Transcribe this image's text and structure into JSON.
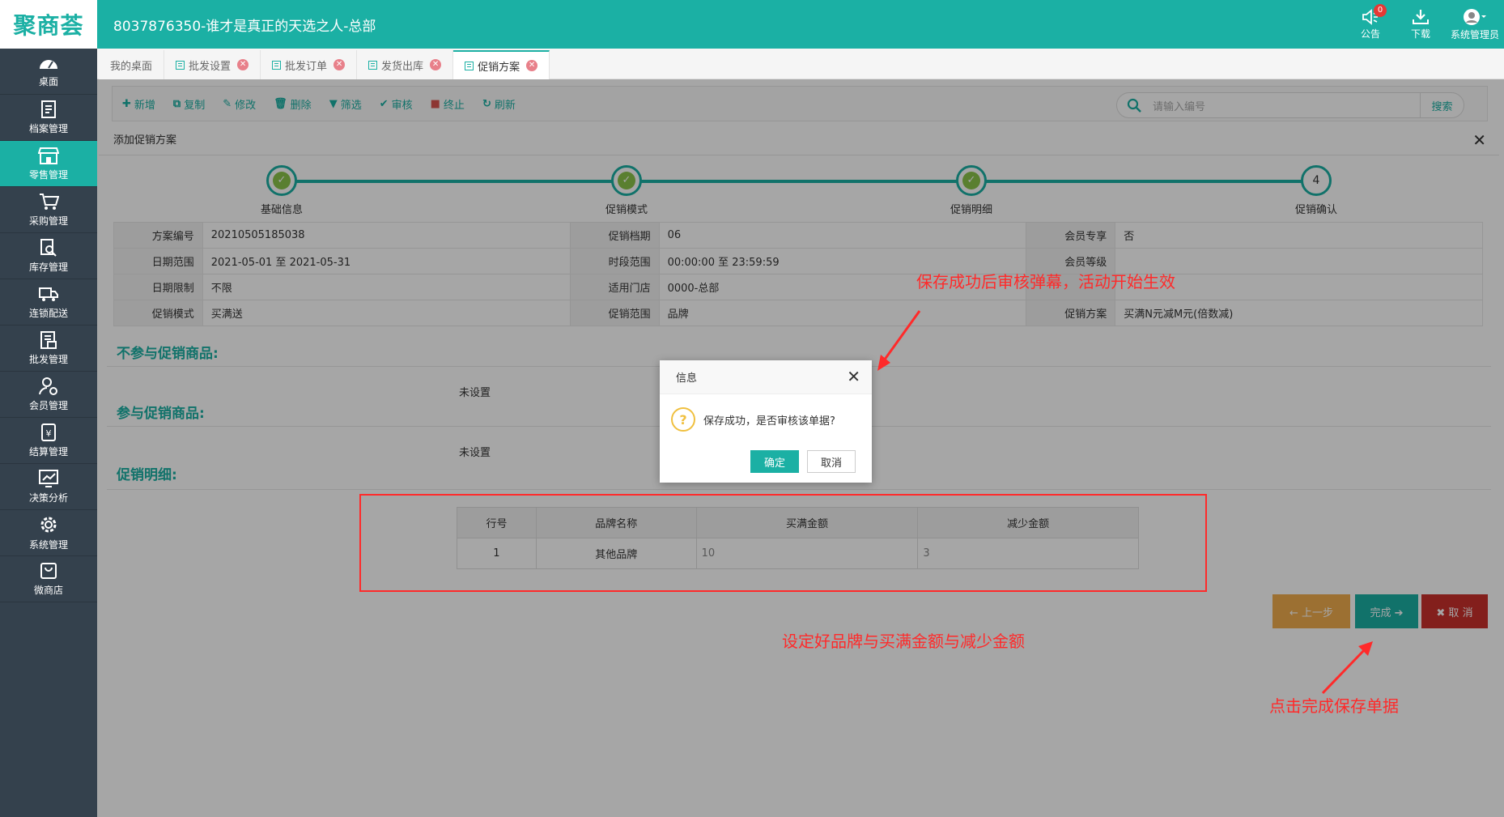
{
  "app": {
    "logo": "聚商荟",
    "title": "8037876350-谁才是真正的天选之人-总部"
  },
  "top_icons": [
    {
      "label": "公告",
      "icon": "speaker-icon",
      "badge": "0"
    },
    {
      "label": "下载",
      "icon": "download-icon"
    },
    {
      "label": "系统管理员",
      "icon": "avatar-icon"
    }
  ],
  "sidebar": [
    {
      "label": "桌面",
      "icon": "dashboard-icon"
    },
    {
      "label": "档案管理",
      "icon": "archive-icon"
    },
    {
      "label": "零售管理",
      "icon": "store-icon",
      "active": true
    },
    {
      "label": "采购管理",
      "icon": "cart-icon"
    },
    {
      "label": "库存管理",
      "icon": "inventory-icon"
    },
    {
      "label": "连锁配送",
      "icon": "truck-icon"
    },
    {
      "label": "批发管理",
      "icon": "wholesale-icon"
    },
    {
      "label": "会员管理",
      "icon": "member-icon"
    },
    {
      "label": "结算管理",
      "icon": "settlement-icon"
    },
    {
      "label": "决策分析",
      "icon": "chart-icon"
    },
    {
      "label": "系统管理",
      "icon": "gear-icon"
    },
    {
      "label": "微商店",
      "icon": "shop-bag-icon"
    }
  ],
  "tabs": [
    {
      "label": "我的桌面"
    },
    {
      "label": "批发设置"
    },
    {
      "label": "批发订单"
    },
    {
      "label": "发货出库"
    },
    {
      "label": "促销方案",
      "active": true
    }
  ],
  "toolbar": {
    "buttons": [
      {
        "label": "新增",
        "glyph": "✚"
      },
      {
        "label": "复制",
        "glyph": "⧉"
      },
      {
        "label": "修改",
        "glyph": "✎"
      },
      {
        "label": "删除",
        "glyph": "🗑"
      },
      {
        "label": "筛选",
        "glyph": "▼"
      },
      {
        "label": "审核",
        "glyph": "✔"
      },
      {
        "label": "终止",
        "glyph": "■"
      },
      {
        "label": "刷新",
        "glyph": "↻"
      }
    ],
    "search_placeholder": "请输入编号",
    "search_button": "搜索"
  },
  "panel": {
    "title": "添加促销方案",
    "steps": [
      {
        "label": "基础信息",
        "done": true
      },
      {
        "label": "促销模式",
        "done": true
      },
      {
        "label": "促销明细",
        "done": true
      },
      {
        "label": "促销确认",
        "done": false,
        "num": "4"
      }
    ],
    "info_rows": [
      [
        {
          "k": "方案编号",
          "v": "20210505185038"
        },
        {
          "k": "促销档期",
          "v": "06"
        },
        {
          "k": "会员专享",
          "v": "否"
        }
      ],
      [
        {
          "k": "日期范围",
          "v": "2021-05-01 至 2021-05-31"
        },
        {
          "k": "时段范围",
          "v": "00:00:00 至 23:59:59"
        },
        {
          "k": "会员等级",
          "v": ""
        }
      ],
      [
        {
          "k": "日期限制",
          "v": "不限"
        },
        {
          "k": "适用门店",
          "v": "0000-总部"
        },
        {
          "k": "",
          "v": ""
        }
      ],
      [
        {
          "k": "促销模式",
          "v": "买满送"
        },
        {
          "k": "促销范围",
          "v": "品牌"
        },
        {
          "k": "促销方案",
          "v": "买满N元减M元(倍数减)"
        }
      ]
    ],
    "excluded_title": "不参与促销商品:",
    "excluded_value": "未设置",
    "included_title": "参与促销商品:",
    "included_value": "未设置",
    "detail_title": "促销明细:",
    "detail_table": {
      "headers": [
        "行号",
        "品牌名称",
        "买满金额",
        "减少金额"
      ],
      "rows": [
        [
          "1",
          "其他品牌",
          "10",
          "3"
        ]
      ]
    },
    "buttons": {
      "prev": "← 上一步",
      "done": "完成 ➔",
      "cancel": "✖ 取 消"
    }
  },
  "dialog": {
    "title": "信息",
    "message": "保存成功，是否审核该单据?",
    "ok": "确定",
    "cancel": "取消"
  },
  "annotations": {
    "top": "保存成功后审核弹幕，活动开始生效",
    "middle": "设定好品牌与买满金额与减少金额",
    "bottom": "点击完成保存单据"
  },
  "colors": {
    "accent": "#1bb0a4",
    "sidebar": "#34414d",
    "annotation": "#ff2a2a"
  }
}
